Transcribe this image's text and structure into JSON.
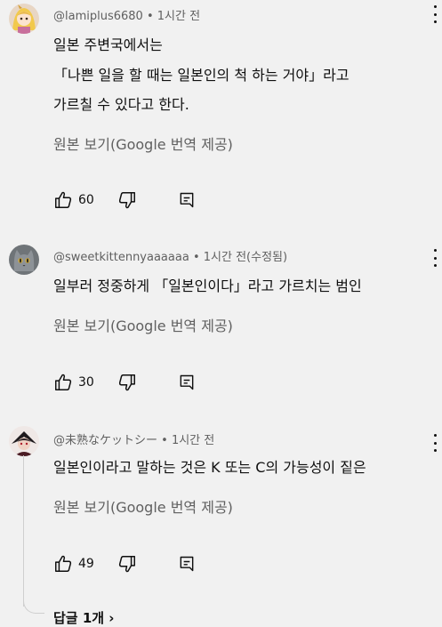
{
  "comments": [
    {
      "author": "@lamiplus6680",
      "sep": " • ",
      "time": "1시간 전",
      "lines": [
        "일본 주변국에서는",
        "「나쁜 일을 할 때는 일본인의 척 하는 거야」라고",
        "가르칠 수 있다고 한다."
      ],
      "translate_label": "원본 보기(Google 번역 제공)",
      "likes": "60",
      "avatar_icon": "anime-girl-avatar"
    },
    {
      "author": "@sweetkittennyaaaaaa",
      "sep": " • ",
      "time": "1시간 전(수정됨)",
      "lines": [
        "일부러 정중하게 「일본인이다」라고 가르치는 범인"
      ],
      "translate_label": "원본 보기(Google 번역 제공)",
      "likes": "30",
      "avatar_icon": "cat-avatar"
    },
    {
      "author": "@未熟なケットシー",
      "sep": " • ",
      "time": "1시간 전",
      "lines": [
        "일본인이라고 말하는 것은 K 또는 C의 가능성이 짙은"
      ],
      "translate_label": "원본 보기(Google 번역 제공)",
      "likes": "49",
      "avatar_icon": "character-avatar"
    }
  ],
  "replies_label": "답글 1개 ›",
  "icons": {
    "like": "thumbs-up-icon",
    "dislike": "thumbs-down-icon",
    "reply": "reply-icon",
    "more": "more-vert-icon"
  },
  "colors": {
    "background": "#f1f1f1",
    "text": "#0f0f0f",
    "secondary": "#606060"
  }
}
